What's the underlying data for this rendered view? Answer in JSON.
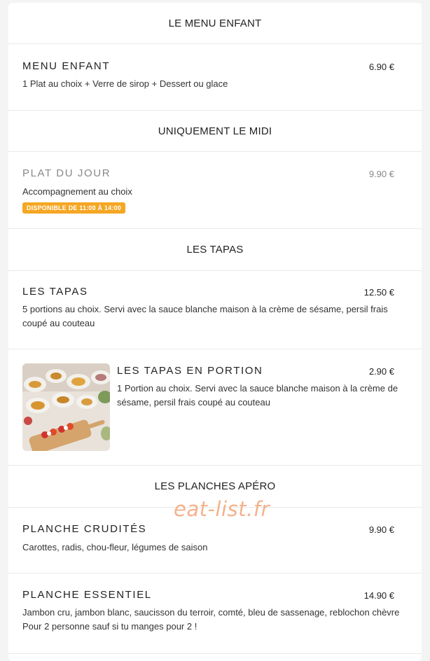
{
  "sections": {
    "kids": {
      "title": "LE MENU ENFANT",
      "item": {
        "name": "MENU ENFANT",
        "price": "6.90 €",
        "desc": "1 Plat au choix + Verre de sirop + Dessert ou glace"
      }
    },
    "midi": {
      "title": "UNIQUEMENT LE MIDI",
      "item": {
        "name": "PLAT DU JOUR",
        "price": "9.90 €",
        "desc": "Accompagnement au choix",
        "badge": "DISPONIBLE DE 11:00 À 14:00"
      }
    },
    "tapas": {
      "title": "LES TAPAS",
      "items": [
        {
          "name": "LES TAPAS",
          "price": "12.50 €",
          "desc": "5 portions au choix. Servi avec la sauce blanche maison à la crème de sésame, persil frais coupé au couteau"
        },
        {
          "name": "LES TAPAS EN PORTION",
          "price": "2.90 €",
          "desc": "1 Portion au choix. Servi avec la sauce blanche maison à la crème de sésame, persil frais coupé au couteau"
        }
      ]
    },
    "planches": {
      "title": "LES PLANCHES APÉRO",
      "items": [
        {
          "name": "PLANCHE CRUDITÉS",
          "price": "9.90 €",
          "desc": "Carottes, radis, chou-fleur, légumes de saison"
        },
        {
          "name": "PLANCHE ESSENTIEL",
          "price": "14.90 €",
          "desc": "Jambon cru, jambon blanc, saucisson du terroir, comté, bleu de sassenage, reblochon chèvre Pour 2 personne sauf si tu manges pour 2 !"
        }
      ]
    }
  },
  "watermark": "eat-list.fr",
  "colors": {
    "badge": "#f5a623",
    "watermark": "#f3b28c",
    "divider": "#e9e9e9"
  }
}
